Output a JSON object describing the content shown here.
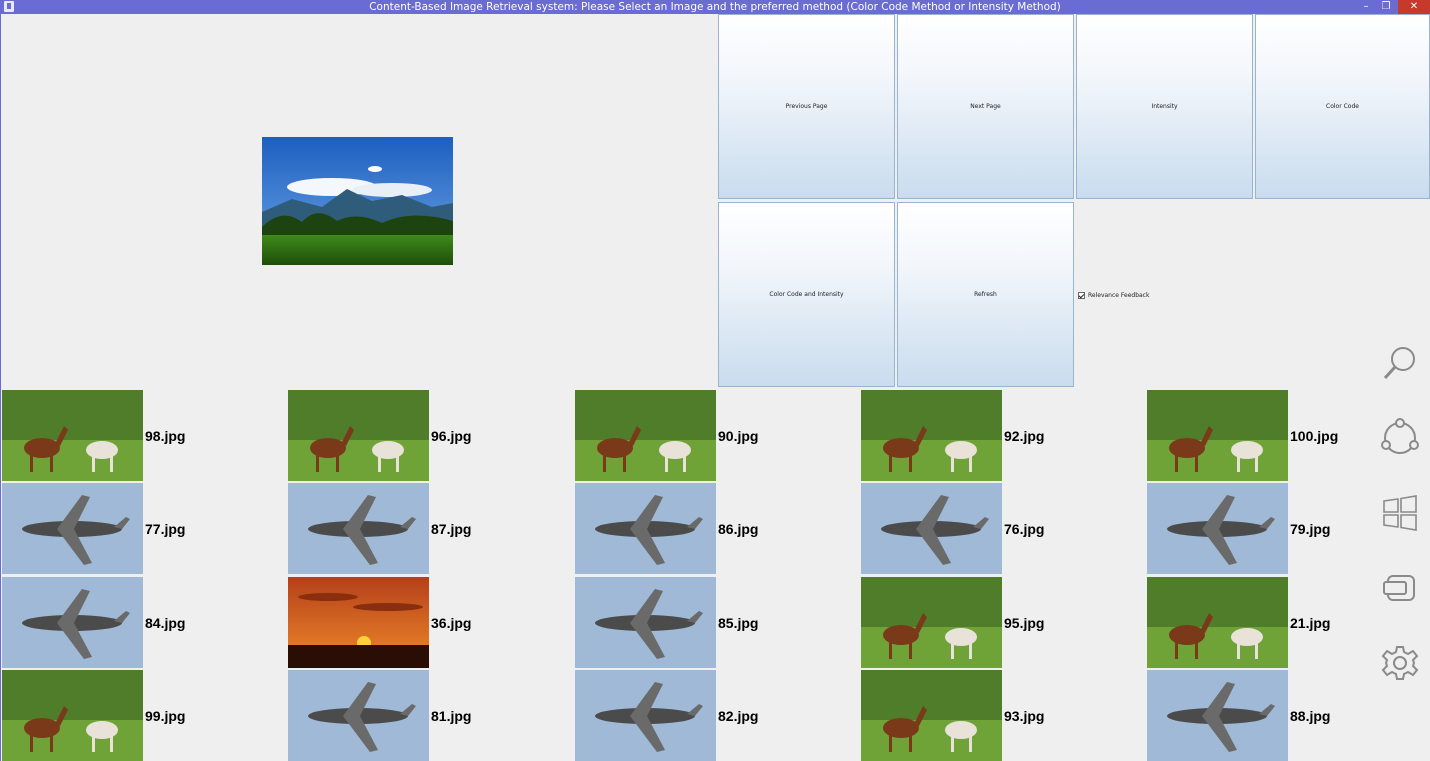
{
  "window": {
    "title": "Content-Based Image Retrieval system: Please Select an Image and the preferred method (Color Code Method or Intensity Method)",
    "controls": [
      "–",
      "❐",
      "✕"
    ]
  },
  "buttons": {
    "previous_page": "Previous Page",
    "next_page": "Next Page",
    "intensity": "Intensity",
    "color_code": "Color Code",
    "color_code_and_intensity": "Color Code and Intensity",
    "refresh": "Refresh"
  },
  "relevance_feedback": {
    "label": "Relevance Feedback",
    "checked": true
  },
  "query_image": {
    "subject": "mountain landscape"
  },
  "results": [
    {
      "file": "98.jpg",
      "subject": "horses"
    },
    {
      "file": "96.jpg",
      "subject": "horses"
    },
    {
      "file": "90.jpg",
      "subject": "horses"
    },
    {
      "file": "92.jpg",
      "subject": "horses"
    },
    {
      "file": "100.jpg",
      "subject": "horses"
    },
    {
      "file": "77.jpg",
      "subject": "plane"
    },
    {
      "file": "87.jpg",
      "subject": "plane"
    },
    {
      "file": "86.jpg",
      "subject": "plane"
    },
    {
      "file": "76.jpg",
      "subject": "plane"
    },
    {
      "file": "79.jpg",
      "subject": "plane"
    },
    {
      "file": "84.jpg",
      "subject": "plane"
    },
    {
      "file": "36.jpg",
      "subject": "sunset"
    },
    {
      "file": "85.jpg",
      "subject": "plane"
    },
    {
      "file": "95.jpg",
      "subject": "horses"
    },
    {
      "file": "21.jpg",
      "subject": "horses"
    },
    {
      "file": "99.jpg",
      "subject": "horses"
    },
    {
      "file": "81.jpg",
      "subject": "plane"
    },
    {
      "file": "82.jpg",
      "subject": "plane"
    },
    {
      "file": "93.jpg",
      "subject": "horses"
    },
    {
      "file": "88.jpg",
      "subject": "plane"
    }
  ],
  "charms": [
    "search-icon",
    "share-icon",
    "start-icon",
    "devices-icon",
    "settings-icon"
  ],
  "colors": {
    "titlebar": "#6b6bd4",
    "background": "#efefef",
    "close": "#c7392b"
  }
}
